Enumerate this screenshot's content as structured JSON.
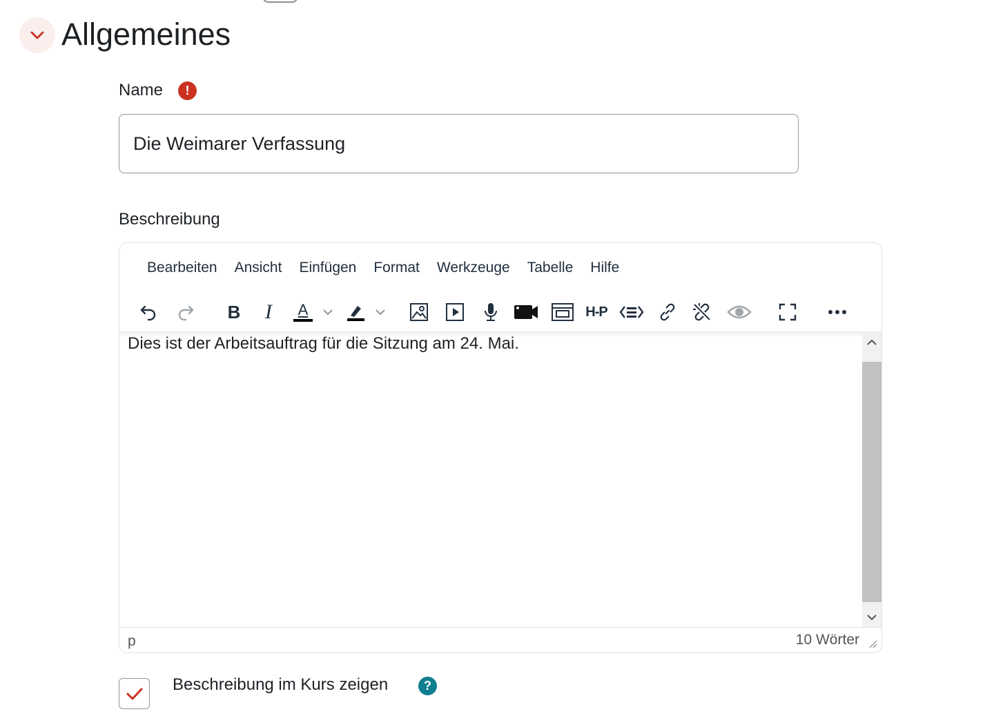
{
  "section": {
    "title": "Allgemeines",
    "collapse_icon": "chevron-down-icon",
    "accent_color": "#ca3120"
  },
  "name_field": {
    "label": "Name",
    "required_icon": "!",
    "value": "Die Weimarer Verfassung"
  },
  "description": {
    "label": "Beschreibung",
    "menu": [
      "Bearbeiten",
      "Ansicht",
      "Einfügen",
      "Format",
      "Werkzeuge",
      "Tabelle",
      "Hilfe"
    ],
    "toolbar": [
      "undo-icon",
      "redo-icon",
      "bold-icon",
      "italic-icon",
      "text-color-icon",
      "highlight-icon",
      "image-icon",
      "media-icon",
      "record-audio-icon",
      "record-video-icon",
      "embed-icon",
      "h5p-icon",
      "html-icon",
      "link-icon",
      "unlink-icon",
      "accessibility-icon",
      "fullscreen-icon",
      "more-icon"
    ],
    "bold_glyph": "B",
    "italic_glyph": "I",
    "color_glyph": "A",
    "h5p_glyph": "H-P",
    "content": "Dies ist der Arbeitsauftrag für die Sitzung am 24. Mai.",
    "status_path": "p",
    "word_count": "10 Wörter"
  },
  "show_in_course": {
    "label": "Beschreibung im Kurs zeigen",
    "checked": true,
    "help_icon": "?"
  }
}
